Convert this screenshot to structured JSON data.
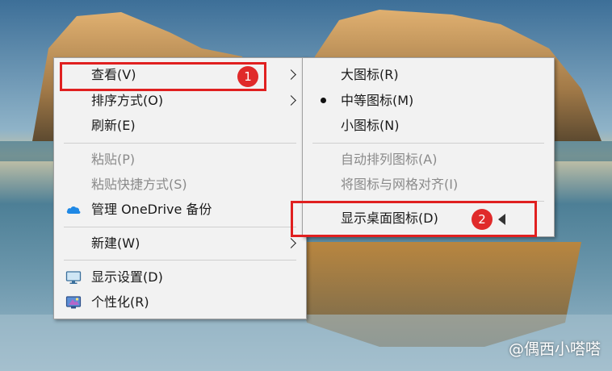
{
  "main_menu": {
    "items": [
      {
        "label": "查看(V)"
      },
      {
        "label": "排序方式(O)"
      },
      {
        "label": "刷新(E)"
      },
      {
        "label": "粘贴(P)"
      },
      {
        "label": "粘贴快捷方式(S)"
      },
      {
        "label": "管理 OneDrive 备份"
      },
      {
        "label": "新建(W)"
      },
      {
        "label": "显示设置(D)"
      },
      {
        "label": "个性化(R)"
      }
    ]
  },
  "sub_menu": {
    "items": [
      {
        "label": "大图标(R)"
      },
      {
        "label": "中等图标(M)"
      },
      {
        "label": "小图标(N)"
      },
      {
        "label": "自动排列图标(A)"
      },
      {
        "label": "将图标与网格对齐(I)"
      },
      {
        "label": "显示桌面图标(D)"
      }
    ],
    "selected_view": "中等图标(M)"
  },
  "annotations": {
    "badge_1": "1",
    "badge_2": "2"
  },
  "watermark": "@偶西小嗒嗒",
  "colors": {
    "highlight_border": "#e02020",
    "menu_bg": "#f2f2f2",
    "onedrive": "#1e88e5"
  },
  "icons": [
    "cloud-icon",
    "monitor-icon",
    "personalize-icon",
    "chevron-right-icon",
    "radio-bullet-icon",
    "pointer-arrow-icon"
  ]
}
